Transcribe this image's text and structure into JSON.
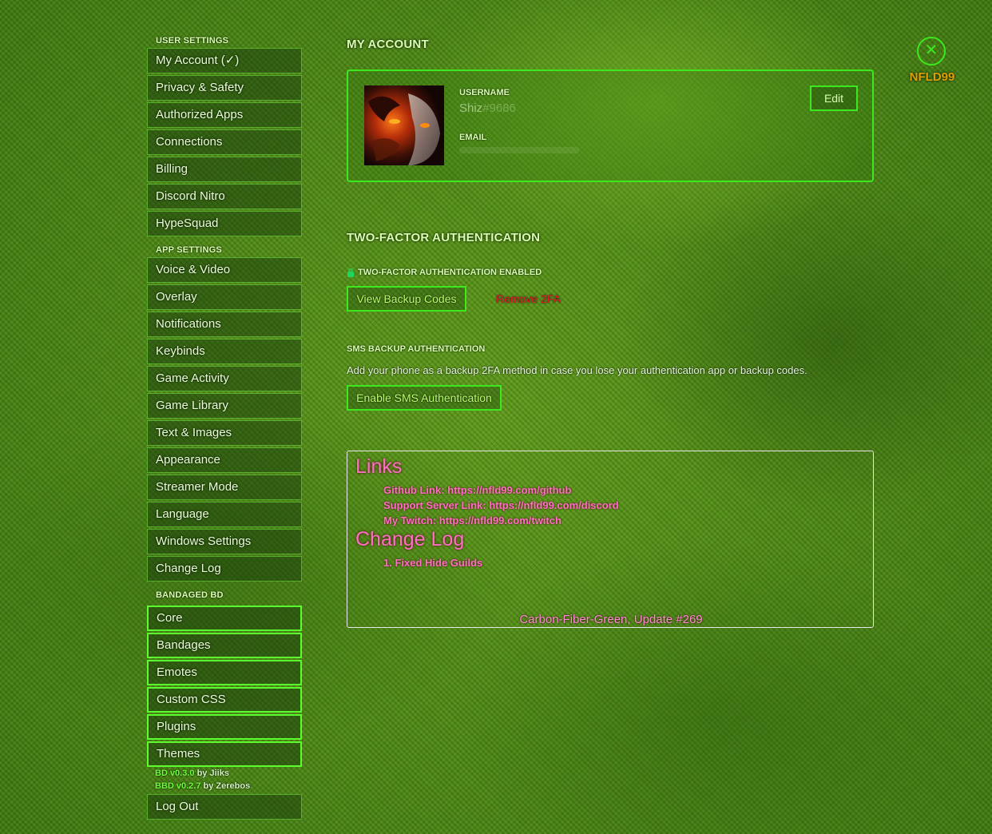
{
  "sidebar": {
    "user_settings_header": "USER SETTINGS",
    "user_items": [
      {
        "label": "My Account (✓)"
      },
      {
        "label": "Privacy & Safety"
      },
      {
        "label": "Authorized Apps"
      },
      {
        "label": "Connections"
      },
      {
        "label": "Billing"
      },
      {
        "label": "Discord Nitro"
      },
      {
        "label": "HypeSquad"
      }
    ],
    "app_settings_header": "APP SETTINGS",
    "app_items": [
      {
        "label": "Voice & Video"
      },
      {
        "label": "Overlay"
      },
      {
        "label": "Notifications"
      },
      {
        "label": "Keybinds"
      },
      {
        "label": "Game Activity"
      },
      {
        "label": "Game Library"
      },
      {
        "label": "Text & Images"
      },
      {
        "label": "Appearance"
      },
      {
        "label": "Streamer Mode"
      },
      {
        "label": "Language"
      },
      {
        "label": "Windows Settings"
      },
      {
        "label": "Change Log"
      }
    ],
    "bd_header": "BANDAGED BD",
    "bd_items": [
      {
        "label": "Core"
      },
      {
        "label": "Bandages"
      },
      {
        "label": "Emotes"
      },
      {
        "label": "Custom CSS"
      },
      {
        "label": "Plugins"
      },
      {
        "label": "Themes"
      }
    ],
    "bd_version": {
      "name": "BD v0.3.0",
      "by": " by Jiiks"
    },
    "bbd_version": {
      "name": "BBD v0.2.7",
      "by": " by Zerebos"
    },
    "logout_label": "Log Out"
  },
  "account": {
    "heading": "MY ACCOUNT",
    "username_label": "USERNAME",
    "username_value": "Shiz",
    "discriminator": "#9686",
    "email_label": "EMAIL",
    "edit_label": "Edit"
  },
  "twofa": {
    "heading": "TWO-FACTOR AUTHENTICATION",
    "enabled_text": "TWO-FACTOR AUTHENTICATION ENABLED",
    "view_backup_label": "View Backup Codes",
    "remove_label": "Remove 2FA",
    "sms_heading": "SMS BACKUP AUTHENTICATION",
    "sms_desc": "Add your phone as a backup 2FA method in case you lose your authentication app or backup codes.",
    "enable_sms_label": "Enable SMS Authentication"
  },
  "links": {
    "title": "Links",
    "github": "Github Link: https://nfld99.com/github",
    "support": "Support Server Link: https://nfld99.com/discord",
    "twitch": "My Twitch: https://nfld99.com/twitch",
    "changelog_title": "Change Log",
    "changelog_item": "1. Fixed Hide Guilds",
    "footer": "Carbon-Fiber-Green, Update #269"
  },
  "close": {
    "icon": "close-icon",
    "glyph": "✕",
    "brand": "NFLD99"
  },
  "colors": {
    "accent": "#3ee81f",
    "link_pink": "#ff6ec7",
    "danger": "#e0202a",
    "brand": "#e0a000"
  }
}
